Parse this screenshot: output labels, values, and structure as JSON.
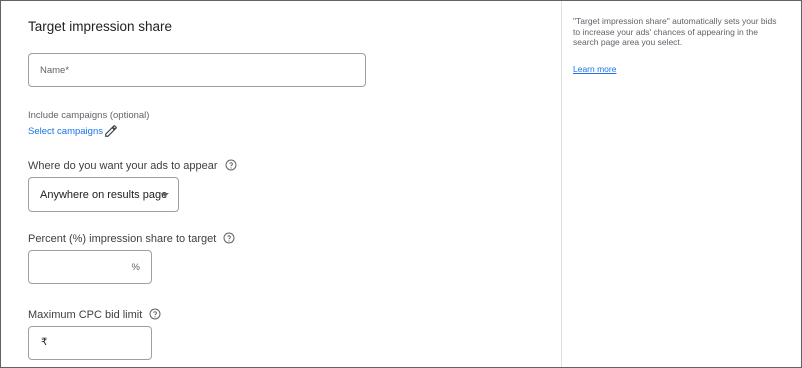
{
  "form": {
    "title": "Target impression share",
    "name_field": {
      "placeholder": "Name*",
      "value": ""
    },
    "include_campaigns": {
      "label": "Include campaigns (optional)",
      "link": "Select campaigns",
      "icon": "pencil-icon"
    },
    "ad_location": {
      "label": "Where do you want your ads to appear",
      "help_icon": "help-circle-icon",
      "selected": "Anywhere on results page"
    },
    "impression_share": {
      "label": "Percent (%) impression share to target",
      "help_icon": "help-circle-icon",
      "value": "",
      "suffix": "%"
    },
    "max_cpc": {
      "label": "Maximum CPC bid limit",
      "help_icon": "help-circle-icon",
      "value": "",
      "currency_prefix": "₹"
    }
  },
  "sidebar": {
    "description": "\"Target impression share\" automatically sets your bids to increase your ads' chances of appearing in the search page area you select.",
    "learn_more": "Learn more"
  },
  "colors": {
    "link": "#1a73e8",
    "border": "#9aa0a6",
    "text": "#3c4043",
    "muted": "#5f6368"
  }
}
